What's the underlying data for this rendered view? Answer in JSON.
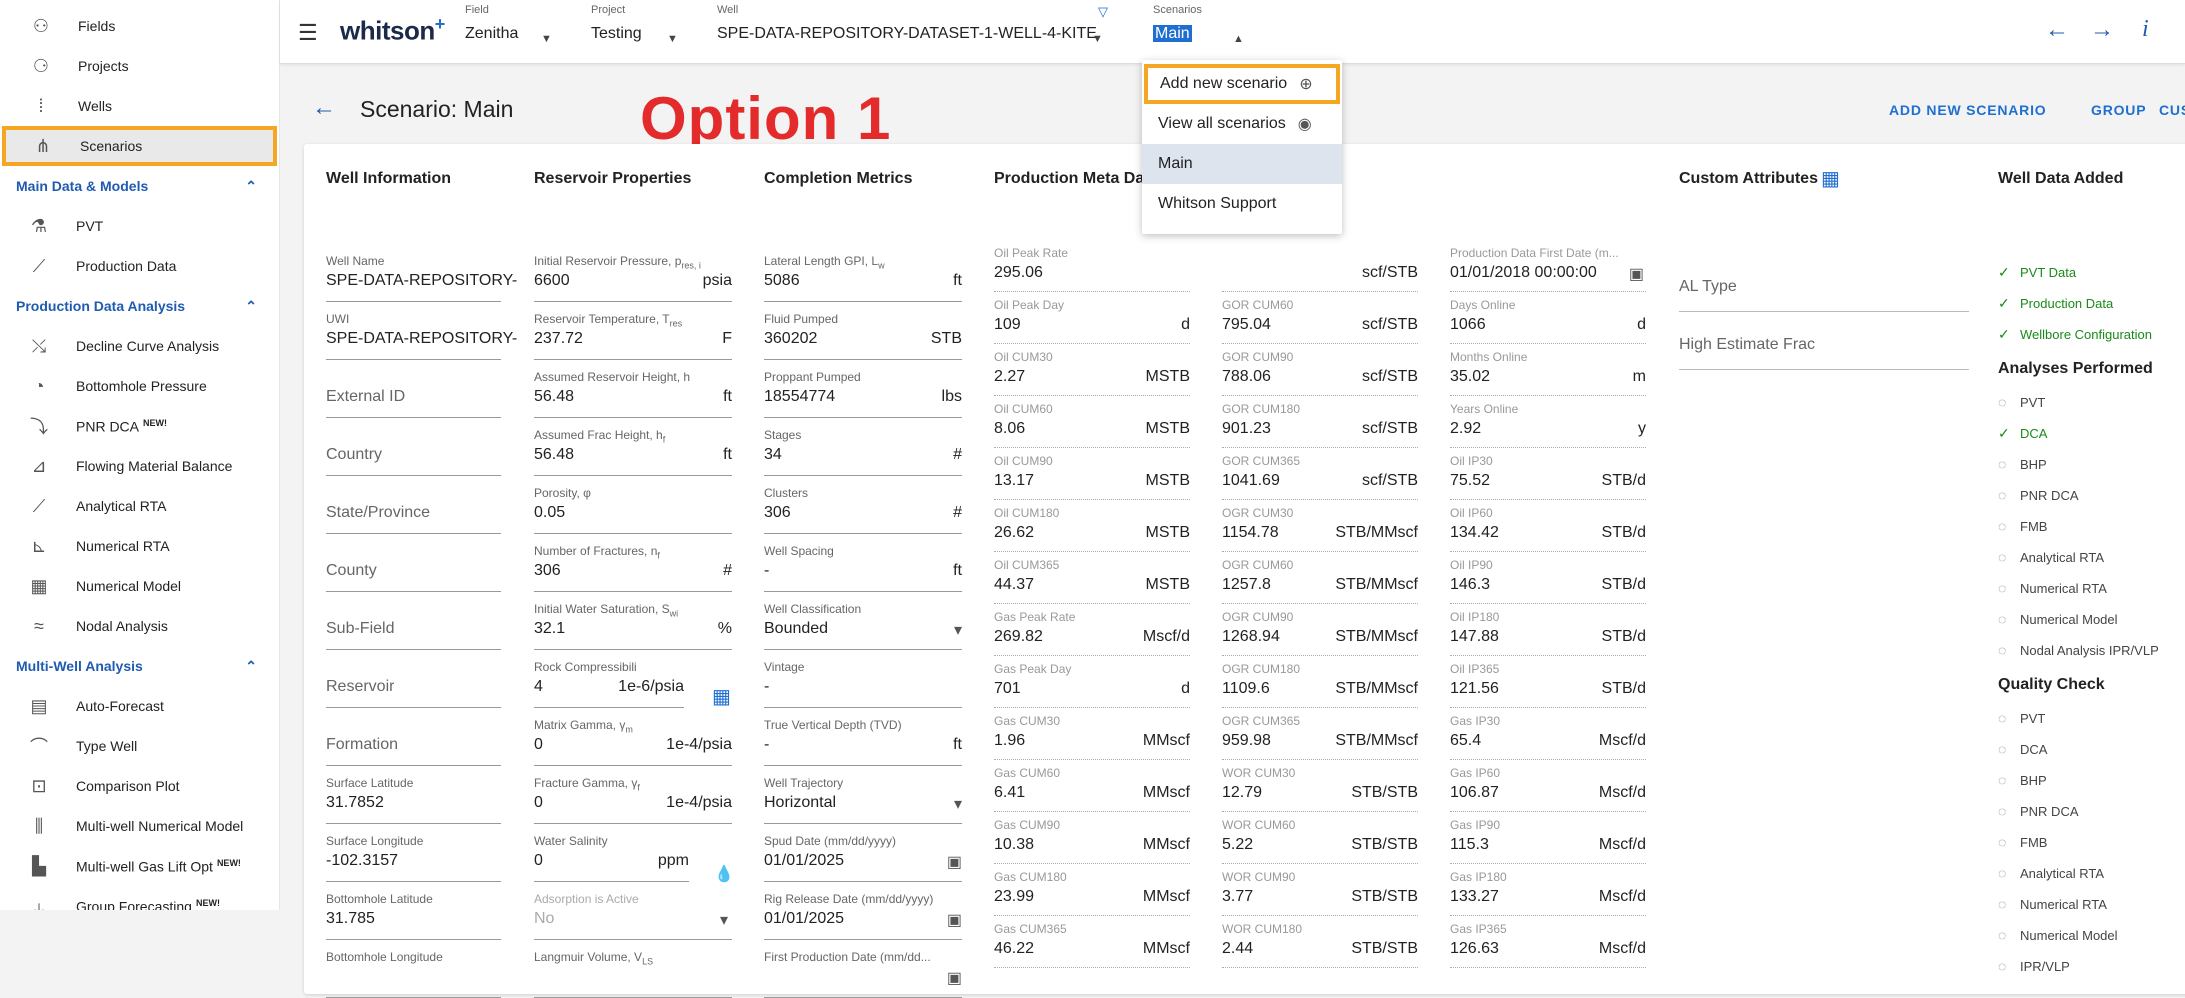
{
  "sidebar": {
    "top_items": [
      {
        "label": "Fields",
        "icon": "fields-icon"
      },
      {
        "label": "Projects",
        "icon": "projects-icon"
      },
      {
        "label": "Wells",
        "icon": "wells-icon"
      },
      {
        "label": "Scenarios",
        "icon": "scenarios-icon"
      }
    ],
    "sections": [
      {
        "title": "Main Data & Models",
        "items": [
          {
            "label": "PVT",
            "icon": "flask-icon"
          },
          {
            "label": "Production Data",
            "icon": "trend-icon"
          }
        ]
      },
      {
        "title": "Production Data Analysis",
        "items": [
          {
            "label": "Decline Curve Analysis",
            "icon": "dca-icon"
          },
          {
            "label": "Bottomhole Pressure",
            "icon": "gauge-icon"
          },
          {
            "label": "PNR DCA",
            "new": "NEW!",
            "icon": "pnr-icon"
          },
          {
            "label": "Flowing Material Balance",
            "icon": "fmb-icon"
          },
          {
            "label": "Analytical RTA",
            "icon": "rta-icon"
          },
          {
            "label": "Numerical RTA",
            "icon": "nrta-icon"
          },
          {
            "label": "Numerical Model",
            "icon": "grid-icon"
          },
          {
            "label": "Nodal Analysis",
            "icon": "nodal-icon"
          }
        ]
      },
      {
        "title": "Multi-Well Analysis",
        "items": [
          {
            "label": "Auto-Forecast",
            "icon": "auto-forecast-icon"
          },
          {
            "label": "Type Well",
            "icon": "type-well-icon"
          },
          {
            "label": "Comparison Plot",
            "icon": "comparison-icon"
          },
          {
            "label": "Multi-well Numerical Model",
            "icon": "multiwell-icon"
          },
          {
            "label": "Multi-well Gas Lift Opt",
            "new": "NEW!",
            "icon": "gaslift-icon"
          },
          {
            "label": "Group Forecasting",
            "new": "NEW!",
            "icon": "group-forecast-icon"
          }
        ]
      }
    ]
  },
  "topbar": {
    "logo": "whitson",
    "logo_sup": "+",
    "field_cap": "Field",
    "field": "Zenitha",
    "project_cap": "Project",
    "project": "Testing",
    "well_cap": "Well",
    "well": "SPE-DATA-REPOSITORY-DATASET-1-WELL-4-KITE",
    "scen_cap": "Scenarios",
    "scen": "Main"
  },
  "header": {
    "title": "Scenario: Main",
    "annotation": "Option 1",
    "actions": [
      "ADD NEW SCENARIO",
      "GROUP",
      "CUS"
    ]
  },
  "menu": {
    "items": [
      "Add new scenario",
      "View all scenarios",
      "Main",
      "Whitson Support"
    ]
  },
  "well_info": {
    "title": "Well Information",
    "fields": [
      {
        "label": "Well Name",
        "value": "SPE-DATA-REPOSITORY-"
      },
      {
        "label": "UWI",
        "value": "SPE-DATA-REPOSITORY-"
      },
      {
        "label": "",
        "value": "External ID"
      },
      {
        "label": "",
        "value": "Country"
      },
      {
        "label": "",
        "value": "State/Province"
      },
      {
        "label": "",
        "value": "County"
      },
      {
        "label": "",
        "value": "Sub-Field"
      },
      {
        "label": "",
        "value": "Reservoir"
      },
      {
        "label": "",
        "value": "Formation"
      },
      {
        "label": "Surface Latitude",
        "value": "31.7852"
      },
      {
        "label": "Surface Longitude",
        "value": "-102.3157"
      },
      {
        "label": "Bottomhole Latitude",
        "value": "31.785"
      },
      {
        "label": "Bottomhole Longitude",
        "value": ""
      }
    ]
  },
  "reservoir": {
    "title": "Reservoir Properties",
    "fields": [
      {
        "label": "Initial Reservoir Pressure, p",
        "sub": "res, i",
        "value": "6600",
        "unit": "psia"
      },
      {
        "label": "Reservoir Temperature, T",
        "sub": "res",
        "value": "237.72",
        "unit": "F"
      },
      {
        "label": "Assumed Reservoir Height, h",
        "value": "56.48",
        "unit": "ft"
      },
      {
        "label": "Assumed Frac Height, h",
        "sub": "f",
        "value": "56.48",
        "unit": "ft"
      },
      {
        "label": "Porosity, φ",
        "value": "0.05",
        "unit": ""
      },
      {
        "label": "Number of Fractures, n",
        "sub": "f",
        "value": "306",
        "unit": "#"
      },
      {
        "label": "Initial Water Saturation, S",
        "sub": "wi",
        "value": "32.1",
        "unit": "%"
      },
      {
        "label": "Rock Compressibili",
        "value": "4",
        "unit": "1e-6/psia"
      },
      {
        "label": "Matrix Gamma, γ",
        "sub": "m",
        "value": "0",
        "unit": "1e-4/psia"
      },
      {
        "label": "Fracture Gamma, γ",
        "sub": "f",
        "value": "0",
        "unit": "1e-4/psia"
      },
      {
        "label": "Water Salinity",
        "value": "0",
        "unit": "ppm"
      },
      {
        "label": "Adsorption is Active",
        "value": "No",
        "unit": ""
      },
      {
        "label": "Langmuir Volume, V",
        "sub": "LS",
        "value": "",
        "unit": ""
      }
    ]
  },
  "completion": {
    "title": "Completion Metrics",
    "fields": [
      {
        "label": "Lateral Length GPI, L",
        "sub": "w",
        "value": "5086",
        "unit": "ft"
      },
      {
        "label": "Fluid Pumped",
        "value": "360202",
        "unit": "STB"
      },
      {
        "label": "Proppant Pumped",
        "value": "18554774",
        "unit": "lbs"
      },
      {
        "label": "Stages",
        "value": "34",
        "unit": "#"
      },
      {
        "label": "Clusters",
        "value": "306",
        "unit": "#"
      },
      {
        "label": "Well Spacing",
        "value": "-",
        "unit": "ft"
      },
      {
        "label": "Well Classification",
        "value": "Bounded",
        "unit": ""
      },
      {
        "label": "Vintage",
        "value": "-",
        "unit": ""
      },
      {
        "label": "True Vertical Depth (TVD)",
        "value": "-",
        "unit": "ft"
      },
      {
        "label": "Well Trajectory",
        "value": "Horizontal",
        "unit": ""
      },
      {
        "label": "Spud Date (mm/dd/yyyy)",
        "value": "01/01/2025",
        "unit": ""
      },
      {
        "label": "Rig Release Date (mm/dd/yyyy)",
        "value": "01/01/2025",
        "unit": ""
      },
      {
        "label": "First Production Date (mm/dd...",
        "value": "",
        "unit": ""
      }
    ]
  },
  "prod_meta": {
    "title": "Production Meta Dat",
    "col1": [
      {
        "label": "Oil Peak Rate",
        "value": "295.06",
        "unit": ""
      },
      {
        "label": "Oil Peak Day",
        "value": "109",
        "unit": "d"
      },
      {
        "label": "Oil CUM30",
        "value": "2.27",
        "unit": "MSTB"
      },
      {
        "label": "Oil CUM60",
        "value": "8.06",
        "unit": "MSTB"
      },
      {
        "label": "Oil CUM90",
        "value": "13.17",
        "unit": "MSTB"
      },
      {
        "label": "Oil CUM180",
        "value": "26.62",
        "unit": "MSTB"
      },
      {
        "label": "Oil CUM365",
        "value": "44.37",
        "unit": "MSTB"
      },
      {
        "label": "Gas Peak Rate",
        "value": "269.82",
        "unit": "Mscf/d"
      },
      {
        "label": "Gas Peak Day",
        "value": "701",
        "unit": "d"
      },
      {
        "label": "Gas CUM30",
        "value": "1.96",
        "unit": "MMscf"
      },
      {
        "label": "Gas CUM60",
        "value": "6.41",
        "unit": "MMscf"
      },
      {
        "label": "Gas CUM90",
        "value": "10.38",
        "unit": "MMscf"
      },
      {
        "label": "Gas CUM180",
        "value": "23.99",
        "unit": "MMscf"
      },
      {
        "label": "Gas CUM365",
        "value": "46.22",
        "unit": "MMscf"
      }
    ],
    "col2": [
      {
        "label": "",
        "value": "",
        "unit": "scf/STB"
      },
      {
        "label": "GOR CUM60",
        "value": "795.04",
        "unit": "scf/STB"
      },
      {
        "label": "GOR CUM90",
        "value": "788.06",
        "unit": "scf/STB"
      },
      {
        "label": "GOR CUM180",
        "value": "901.23",
        "unit": "scf/STB"
      },
      {
        "label": "GOR CUM365",
        "value": "1041.69",
        "unit": "scf/STB"
      },
      {
        "label": "OGR CUM30",
        "value": "1154.78",
        "unit": "STB/MMscf"
      },
      {
        "label": "OGR CUM60",
        "value": "1257.8",
        "unit": "STB/MMscf"
      },
      {
        "label": "OGR CUM90",
        "value": "1268.94",
        "unit": "STB/MMscf"
      },
      {
        "label": "OGR CUM180",
        "value": "1109.6",
        "unit": "STB/MMscf"
      },
      {
        "label": "OGR CUM365",
        "value": "959.98",
        "unit": "STB/MMscf"
      },
      {
        "label": "WOR CUM30",
        "value": "12.79",
        "unit": "STB/STB"
      },
      {
        "label": "WOR CUM60",
        "value": "5.22",
        "unit": "STB/STB"
      },
      {
        "label": "WOR CUM90",
        "value": "3.77",
        "unit": "STB/STB"
      },
      {
        "label": "WOR CUM180",
        "value": "2.44",
        "unit": "STB/STB"
      }
    ],
    "col3": [
      {
        "label": "Production Data First Date (m...",
        "value": "01/01/2018 00:00:00",
        "unit": ""
      },
      {
        "label": "Days Online",
        "value": "1066",
        "unit": "d"
      },
      {
        "label": "Months Online",
        "value": "35.02",
        "unit": "m"
      },
      {
        "label": "Years Online",
        "value": "2.92",
        "unit": "y"
      },
      {
        "label": "Oil IP30",
        "value": "75.52",
        "unit": "STB/d"
      },
      {
        "label": "Oil IP60",
        "value": "134.42",
        "unit": "STB/d"
      },
      {
        "label": "Oil IP90",
        "value": "146.3",
        "unit": "STB/d"
      },
      {
        "label": "Oil IP180",
        "value": "147.88",
        "unit": "STB/d"
      },
      {
        "label": "Oil IP365",
        "value": "121.56",
        "unit": "STB/d"
      },
      {
        "label": "Gas IP30",
        "value": "65.4",
        "unit": "Mscf/d"
      },
      {
        "label": "Gas IP60",
        "value": "106.87",
        "unit": "Mscf/d"
      },
      {
        "label": "Gas IP90",
        "value": "115.3",
        "unit": "Mscf/d"
      },
      {
        "label": "Gas IP180",
        "value": "133.27",
        "unit": "Mscf/d"
      },
      {
        "label": "Gas IP365",
        "value": "126.63",
        "unit": "Mscf/d"
      }
    ]
  },
  "custom": {
    "title": "Custom Attributes",
    "fields": [
      "AL Type",
      "High Estimate Frac"
    ]
  },
  "well_data": {
    "title": "Well Data Added",
    "items": [
      "PVT Data",
      "Production Data",
      "Wellbore Configuration"
    ]
  },
  "analyses": {
    "title": "Analyses Performed",
    "items": [
      {
        "label": "PVT",
        "done": false
      },
      {
        "label": "DCA",
        "done": true
      },
      {
        "label": "BHP",
        "done": false
      },
      {
        "label": "PNR DCA",
        "done": false
      },
      {
        "label": "FMB",
        "done": false
      },
      {
        "label": "Analytical RTA",
        "done": false
      },
      {
        "label": "Numerical RTA",
        "done": false
      },
      {
        "label": "Numerical Model",
        "done": false
      },
      {
        "label": "Nodal Analysis IPR/VLP",
        "done": false
      }
    ]
  },
  "quality": {
    "title": "Quality Check",
    "items": [
      "PVT",
      "DCA",
      "BHP",
      "PNR DCA",
      "FMB",
      "Analytical RTA",
      "Numerical RTA",
      "Numerical Model",
      "IPR/VLP"
    ]
  },
  "colors": {
    "accent": "#1f5bb0",
    "highlight": "#f5a623",
    "annotation": "#e32b2b",
    "ok": "#1a8a1a"
  }
}
